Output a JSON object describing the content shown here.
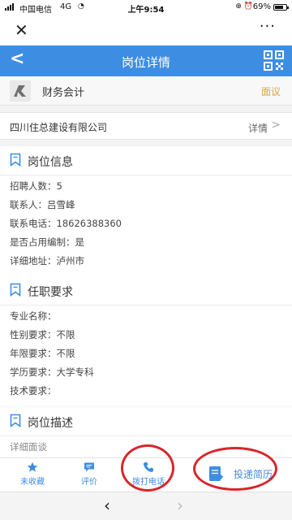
{
  "status": {
    "carrier": "中国电信",
    "network": "4G",
    "time": "上午9:54",
    "battery_pct": "69%"
  },
  "top_bar": {
    "close_icon": "close-icon",
    "more_label": "···"
  },
  "nav": {
    "back_icon": "back-chevron-icon",
    "title": "岗位详情",
    "qr_icon": "qr-code-icon"
  },
  "job": {
    "title": "财务会计",
    "salary": "面议"
  },
  "company": {
    "name": "四川住总建设有限公司",
    "detail_link": "详情",
    "chevron": ">"
  },
  "sections": [
    {
      "title": "岗位信息",
      "rows": [
        "招聘人数：5",
        "联系人：吕雪峰",
        "联系电话：18626388360",
        "是否占用编制：是",
        "详细地址：泸州市"
      ]
    },
    {
      "title": "任职要求",
      "rows": [
        "专业名称：",
        "性别要求：不限",
        "年限要求：不限",
        "学历要求：大学专科",
        "技术要求："
      ]
    },
    {
      "title": "岗位描述",
      "rows": [
        "详细面谈"
      ]
    }
  ],
  "bottom_bar": {
    "favorite": "未收藏",
    "review": "评价",
    "call": "拨打电话",
    "resume": "投递简历"
  },
  "browser": {
    "back": "‹",
    "forward": "›"
  },
  "colors": {
    "accent": "#3d8ee2",
    "salary": "#d9a441",
    "annotation": "#d8262c"
  }
}
